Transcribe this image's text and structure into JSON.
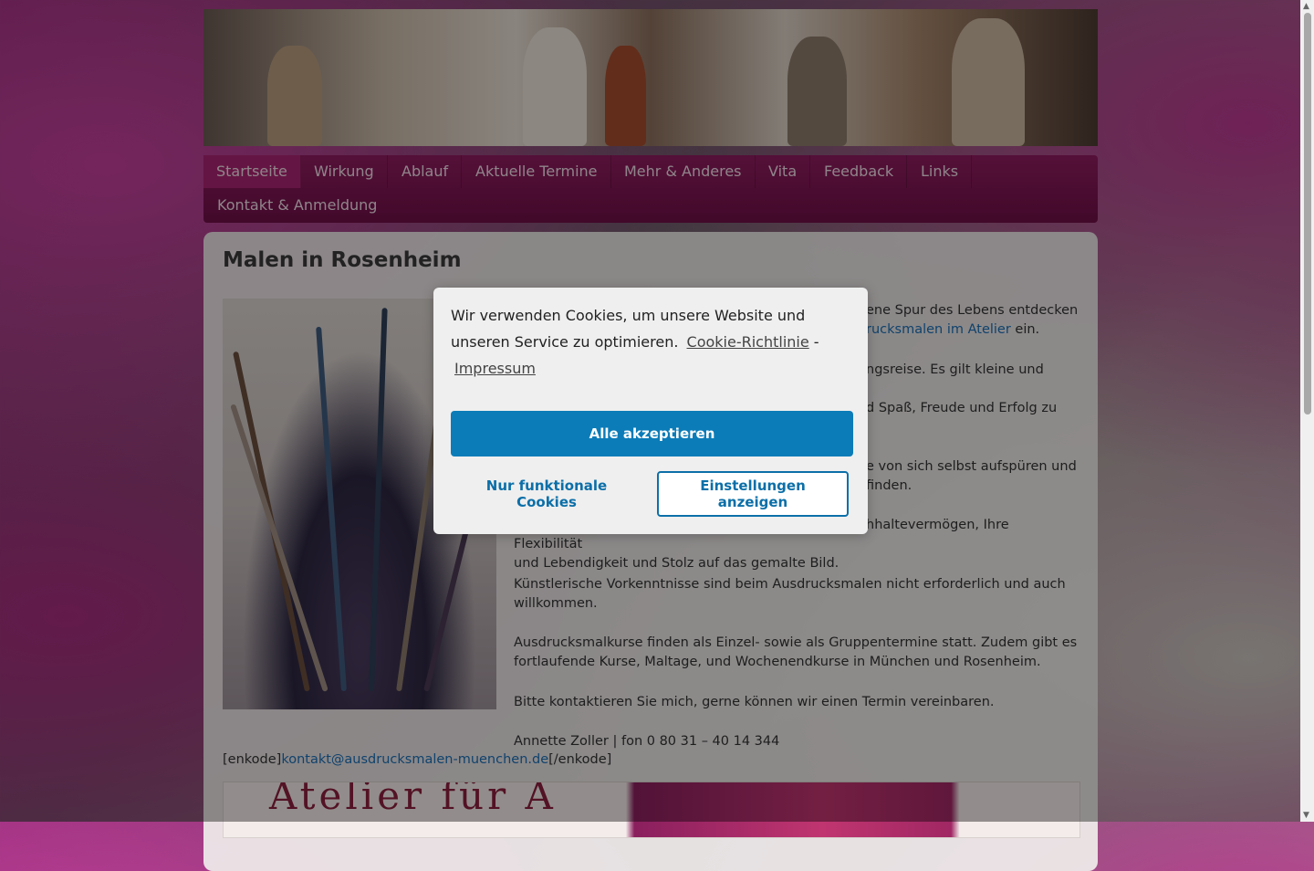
{
  "nav": {
    "items": [
      "Startseite",
      "Wirkung",
      "Ablauf",
      "Aktuelle Termine",
      "Mehr & Anderes",
      "Vita",
      "Feedback",
      "Links",
      "Kontakt & Anmeldung"
    ]
  },
  "main": {
    "title": "Malen in Rosenheim",
    "paragraphs": {
      "p1_visible": "ene Spur des Lebens entdecken",
      "p1_link": "rucksmalen im Atelier",
      "p1_end": " ein.",
      "p2_visible": "ngsreise. Es gilt kleine und",
      "p3_visible": "d Spaß, Freude und Erfolg zu",
      "p4_line1": "e von sich selbst aufspüren und",
      "p4_line2": "finden.",
      "p5_line1": "hhaltevermögen, Ihre Flexibilität",
      "p5_line2": "und Lebendigkeit und Stolz auf das gemalte Bild.",
      "p6": "Künstlerische Vorkenntnisse sind beim Ausdrucksmalen nicht erforderlich und auch willkommen.",
      "p7": "Ausdrucksmalkurse finden als Einzel- sowie als Gruppentermine statt. Zudem gibt es fortlaufende Kurse, Maltage, und Wochenendkurse in München und Rosenheim.",
      "p8": "Bitte kontaktieren Sie mich, gerne können wir einen Termin vereinbaren.",
      "contact": "Annette Zoller | fon 0 80 31 – 40 14 344"
    },
    "email": {
      "prefix": "[enkode]",
      "address": "kontakt@ausdrucksmalen-muenchen.de",
      "suffix": "[/enkode]"
    },
    "banner_text": "Atelier für A"
  },
  "cookie_dialog": {
    "message": "Wir verwenden Cookies, um unsere Website und unseren Service zu optimieren.",
    "policy_link": "Cookie-Richtlinie",
    "separator": "-",
    "imprint_link": "Impressum",
    "accept_all": "Alle akzeptieren",
    "functional_only": "Nur funktionale Cookies",
    "show_settings": "Einstellungen anzeigen"
  },
  "colors": {
    "nav_bg": "#7e1652",
    "nav_active": "#a82470",
    "accept_button": "#0b7cb8",
    "link": "#1a6fb5"
  }
}
